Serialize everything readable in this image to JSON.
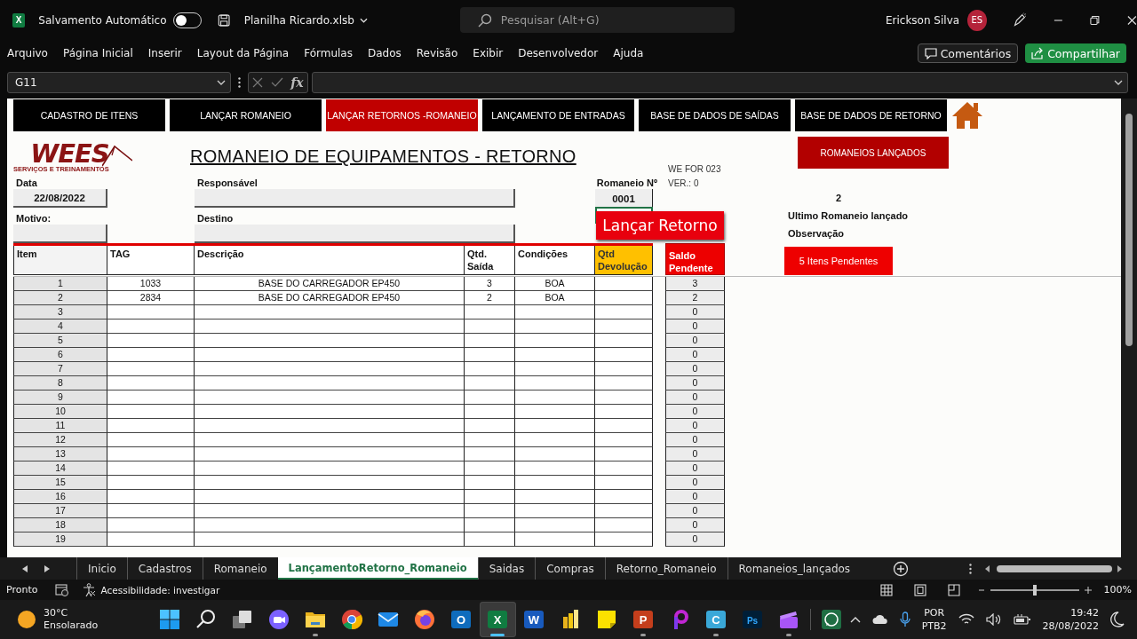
{
  "window": {
    "app_letter": "X",
    "autosave_label": "Salvamento Automático",
    "autosave_on": false,
    "file_name": "Planilha Ricardo.xlsb",
    "search_placeholder": "Pesquisar (Alt+G)",
    "user_name": "Erickson Silva",
    "user_initials": "ES"
  },
  "ribbon_tabs": [
    "Arquivo",
    "Página Inicial",
    "Inserir",
    "Layout da Página",
    "Fórmulas",
    "Dados",
    "Revisão",
    "Exibir",
    "Desenvolvedor",
    "Ajuda"
  ],
  "comments_button": "Comentários",
  "share_button": "Compartilhar",
  "formula_bar": {
    "name_box": "G11",
    "function_symbol": "fx"
  },
  "sheet": {
    "nav_buttons": [
      {
        "label": "CADASTRO DE  ITENS",
        "selected": false
      },
      {
        "label": "LANÇAR ROMANEIO",
        "selected": false
      },
      {
        "label": "LANÇAR RETORNOS -ROMANEIO",
        "selected": true
      },
      {
        "label": "LANÇAMENTO DE ENTRADAS",
        "selected": false
      },
      {
        "label": "BASE DE DADOS DE SAÍDAS",
        "selected": false
      },
      {
        "label": "BASE DE DADOS DE RETORNO",
        "selected": false
      }
    ],
    "logo": {
      "name": "WEES",
      "tagline": "SERVIÇOS E TREINAMENTOS"
    },
    "title": "ROMANEIO DE EQUIPAMENTOS - RETORNO",
    "form_code": "WE FOR 023",
    "version": "VER.: 0",
    "launched_button": "ROMANEIOS LANÇADOS",
    "date": {
      "label": "Data",
      "value": "22/08/2022"
    },
    "responsible": {
      "label": "Responsável"
    },
    "reason": {
      "label": "Motivo:"
    },
    "destination": {
      "label": "Destino"
    },
    "romaneio_number": {
      "label": "Romaneio Nº",
      "value": "0001"
    },
    "launch_button": "Lançar Retorno",
    "last_romaneio": {
      "value": "2",
      "label": "Ultimo Romaneio lançado"
    },
    "observation_label": "Observação",
    "pending_button": "5  Itens Pendentes",
    "table": {
      "columns": [
        {
          "label": "Item",
          "highlighted": false
        },
        {
          "label": "TAG",
          "highlighted": false
        },
        {
          "label": "Descrição",
          "highlighted": false
        },
        {
          "label": "Qtd. Saída",
          "highlighted": false
        },
        {
          "label": "Condições",
          "highlighted": false
        },
        {
          "label": "Qtd Devolução",
          "highlighted": true
        }
      ],
      "balance_column": "Saldo Pendente",
      "rows": [
        {
          "item": "1",
          "tag": "1033",
          "description": "BASE DO CARREGADOR EP450",
          "quantity_out": "3",
          "condition": "BOA",
          "balance": "3"
        },
        {
          "item": "2",
          "tag": "2834",
          "description": "BASE DO CARREGADOR EP450",
          "quantity_out": "2",
          "condition": "BOA",
          "balance": "2"
        },
        {
          "item": "3",
          "balance": "0"
        },
        {
          "item": "4",
          "balance": "0"
        },
        {
          "item": "5",
          "balance": "0"
        },
        {
          "item": "6",
          "balance": "0"
        },
        {
          "item": "7",
          "balance": "0"
        },
        {
          "item": "8",
          "balance": "0"
        },
        {
          "item": "9",
          "balance": "0"
        },
        {
          "item": "10",
          "balance": "0"
        },
        {
          "item": "11",
          "balance": "0"
        },
        {
          "item": "12",
          "balance": "0"
        },
        {
          "item": "13",
          "balance": "0"
        },
        {
          "item": "14",
          "balance": "0"
        },
        {
          "item": "15",
          "balance": "0"
        },
        {
          "item": "16",
          "balance": "0"
        },
        {
          "item": "17",
          "balance": "0"
        },
        {
          "item": "18",
          "balance": "0"
        },
        {
          "item": "19",
          "balance": "0"
        }
      ]
    }
  },
  "sheet_tabs": [
    {
      "label": "Inicio",
      "selected": false
    },
    {
      "label": "Cadastros",
      "selected": false
    },
    {
      "label": "Romaneio",
      "selected": false
    },
    {
      "label": "LançamentoRetorno_Romaneio",
      "selected": true
    },
    {
      "label": "Saidas",
      "selected": false
    },
    {
      "label": "Compras",
      "selected": false
    },
    {
      "label": "Retorno_Romaneio",
      "selected": false
    },
    {
      "label": "Romaneios_lançados",
      "selected": false
    }
  ],
  "status_bar": {
    "status": "Pronto",
    "accessibility": "Acessibilidade: investigar",
    "zoom_slider": {
      "level": 0.5
    },
    "zoom": "100%"
  },
  "taskbar": {
    "temperature": "30°C",
    "weather": "Ensolarado",
    "apps": [
      {
        "kind": "start",
        "running": false,
        "selected": false
      },
      {
        "kind": "search",
        "running": false,
        "selected": false
      },
      {
        "kind": "task_view",
        "running": false,
        "selected": false
      },
      {
        "kind": "chat",
        "running": false,
        "selected": false
      },
      {
        "kind": "folder",
        "running": true,
        "selected": false
      },
      {
        "kind": "chrome",
        "running": false,
        "selected": false
      },
      {
        "kind": "mail",
        "running": false,
        "selected": false
      },
      {
        "kind": "firefox",
        "running": false,
        "selected": false
      },
      {
        "kind": "letter",
        "glyph": "O",
        "color": "#0f6cbd",
        "running": false,
        "selected": false
      },
      {
        "kind": "letter",
        "glyph": "X",
        "color": "#107c41",
        "running": true,
        "selected": true
      },
      {
        "kind": "letter",
        "glyph": "W",
        "color": "#185abd",
        "running": false,
        "selected": false
      },
      {
        "kind": "bars",
        "running": false,
        "selected": false
      },
      {
        "kind": "note",
        "running": false,
        "selected": false
      },
      {
        "kind": "letter",
        "glyph": "P",
        "color": "#c43e1c",
        "running": true,
        "selected": false
      },
      {
        "kind": "ring",
        "running": false,
        "selected": false
      },
      {
        "kind": "letter",
        "glyph": "C",
        "color": "#3aa8d8",
        "running": true,
        "selected": false
      },
      {
        "kind": "letter",
        "glyph": "Ps",
        "color": "#001e36",
        "running": false,
        "selected": false
      },
      {
        "kind": "clapper",
        "running": true,
        "selected": false
      },
      {
        "kind": "separator"
      },
      {
        "kind": "whatsapp",
        "running": false,
        "selected": false
      }
    ],
    "language": "POR",
    "keyboard": "PTB2",
    "time": "19:42",
    "date": "28/08/2022"
  }
}
